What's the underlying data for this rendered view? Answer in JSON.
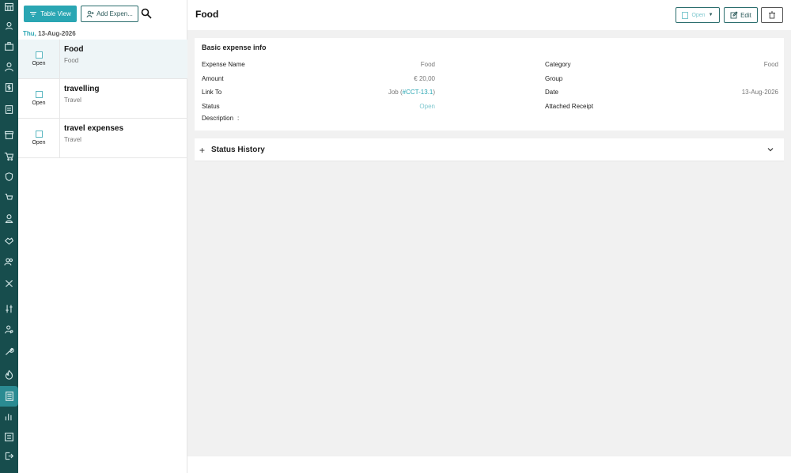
{
  "rail": {
    "icons": [
      "calendar-grid-icon",
      "location-user-icon",
      "briefcase-icon",
      "user-icon",
      "dollar-doc-icon",
      "document-icon",
      "archive-icon",
      "cart-icon",
      "shield-icon",
      "cart-alt-icon",
      "person-shield-icon",
      "handshake-icon",
      "users-icon",
      "tools-icon",
      "sliders-icon",
      "person-gear-icon",
      "wrench-icon",
      "fire-icon",
      "expenses-icon",
      "bar-chart-icon",
      "list-doc-icon",
      "logout-icon"
    ],
    "active_icon": "expenses-icon"
  },
  "toolbar": {
    "table_view_label": "Table View",
    "add_expense_label": "Add Expen..."
  },
  "list": {
    "date_dow": "Thu,",
    "date_value": "13-Aug-2026",
    "rows": [
      {
        "title": "Food",
        "subtitle": "Food",
        "status": "Open"
      },
      {
        "title": "travelling",
        "subtitle": "Travel",
        "status": "Open"
      },
      {
        "title": "travel expenses",
        "subtitle": "Travel",
        "status": "Open"
      }
    ]
  },
  "detail": {
    "title": "Food",
    "status_button": "Open",
    "edit_label": "Edit",
    "card_title": "Basic expense info",
    "fields": {
      "expense_name_label": "Expense Name",
      "expense_name_value": "Food",
      "amount_label": "Amount",
      "amount_value": "€ 20,00",
      "link_to_label": "Link To",
      "link_prefix": "Job (",
      "link_ref": "#CCT-13.1",
      "link_suffix": ")",
      "status_label": "Status",
      "status_value": "Open",
      "description_label": "Description",
      "description_sep": ":",
      "category_label": "Category",
      "category_value": "Food",
      "group_label": "Group",
      "date_label": "Date",
      "date_value": "13-Aug-2026",
      "receipt_label": "Attached Receipt"
    },
    "history_title": "Status History"
  },
  "colors": {
    "accent": "#2aa6b3",
    "rail": "#174d4d",
    "border_dark": "#2c6e6e"
  }
}
